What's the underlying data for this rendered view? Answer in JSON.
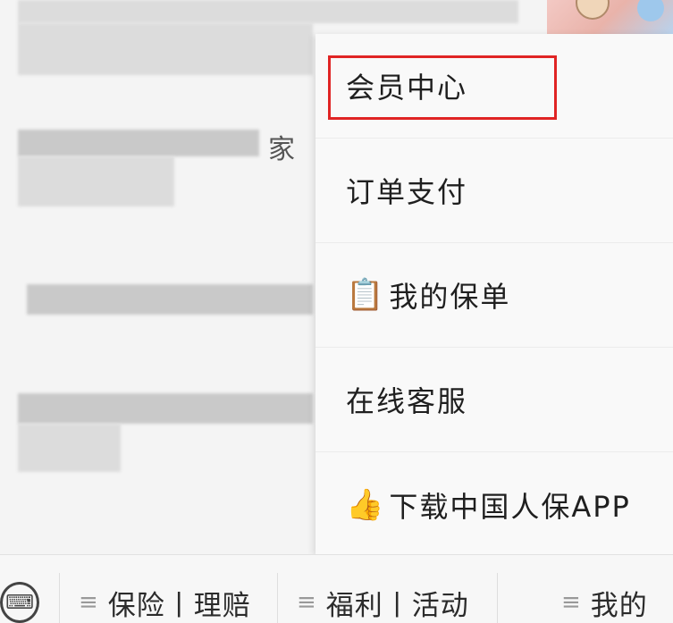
{
  "background": {
    "snippet_1": "家"
  },
  "menu": {
    "items": [
      {
        "label": "会员中心",
        "icon": ""
      },
      {
        "label": "订单支付",
        "icon": ""
      },
      {
        "label": "我的保单",
        "icon": "📋"
      },
      {
        "label": "在线客服",
        "icon": ""
      },
      {
        "label": "下载中国人保APP",
        "icon": "👍"
      }
    ],
    "highlight_color": "#e02424"
  },
  "bottom_bar": {
    "keyboard_icon": "keyboard-icon",
    "tabs": [
      {
        "label": "保险丨理赔"
      },
      {
        "label": "福利丨活动"
      },
      {
        "label": "我的"
      }
    ]
  }
}
